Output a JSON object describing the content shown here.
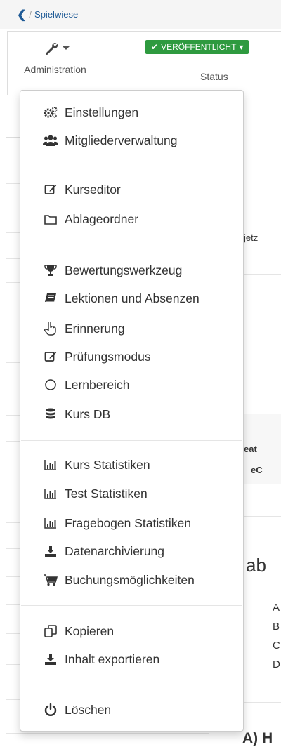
{
  "breadcrumb": {
    "back_icon": "chevron-left-icon",
    "separator": "/",
    "current": "Spielwiese"
  },
  "toolbar": {
    "admin": {
      "icon": "wrench-icon",
      "label": "Administration"
    },
    "status": {
      "badge": "VERÖFFENTLICHT",
      "label": "Status",
      "color": "#2e9a3f"
    }
  },
  "background": {
    "frag_1": "jetz",
    "frag_2": "eat",
    "frag_3": "eC",
    "frag_4": "ab",
    "frag_5": "A",
    "frag_6": "B",
    "frag_7": "C",
    "frag_8": "D",
    "frag_9": "A) H"
  },
  "menu": {
    "items": [
      {
        "label": "Einstellungen",
        "icon": "gears-icon"
      },
      {
        "label": "Mitgliederverwaltung",
        "icon": "users-icon"
      },
      {
        "label": "Kurseditor",
        "icon": "edit-icon"
      },
      {
        "label": "Ablageordner",
        "icon": "folder-icon"
      },
      {
        "label": "Bewertungswerkzeug",
        "icon": "trophy-icon"
      },
      {
        "label": "Lektionen und Absenzen",
        "icon": "book-icon"
      },
      {
        "label": "Erinnerung",
        "icon": "hand-pointer-icon"
      },
      {
        "label": "Prüfungsmodus",
        "icon": "edit-icon"
      },
      {
        "label": "Lernbereich",
        "icon": "circle-icon"
      },
      {
        "label": "Kurs DB",
        "icon": "database-icon"
      },
      {
        "label": "Kurs Statistiken",
        "icon": "bar-chart-icon"
      },
      {
        "label": "Test Statistiken",
        "icon": "bar-chart-icon"
      },
      {
        "label": "Fragebogen Statistiken",
        "icon": "bar-chart-icon"
      },
      {
        "label": "Datenarchivierung",
        "icon": "download-icon"
      },
      {
        "label": "Buchungsmöglichkeiten",
        "icon": "cart-icon"
      },
      {
        "label": "Kopieren",
        "icon": "copy-icon"
      },
      {
        "label": "Inhalt exportieren",
        "icon": "download-icon"
      },
      {
        "label": "Löschen",
        "icon": "power-icon"
      }
    ]
  }
}
